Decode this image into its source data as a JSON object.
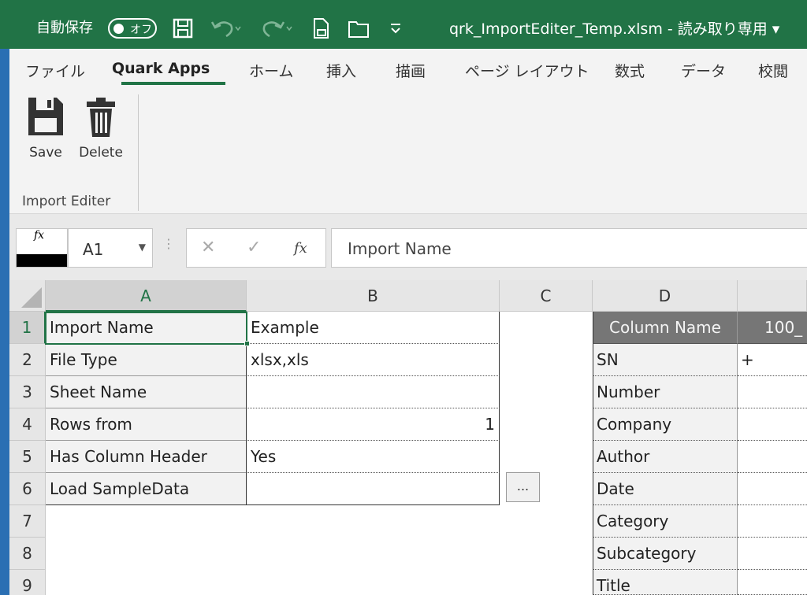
{
  "titlebar": {
    "autosave_label": "自動保存",
    "autosave_state": "オフ",
    "filename": "qrk_ImportEditer_Temp.xlsm  -  読み取り専用 ▾"
  },
  "tabs": [
    {
      "label": "ファイル"
    },
    {
      "label": "Quark Apps"
    },
    {
      "label": "ホーム"
    },
    {
      "label": "挿入"
    },
    {
      "label": "描画"
    },
    {
      "label": "ページ レイアウト"
    },
    {
      "label": "数式"
    },
    {
      "label": "データ"
    },
    {
      "label": "校閲"
    }
  ],
  "ribbon": {
    "save_label": "Save",
    "delete_label": "Delete",
    "group_label": "Import Editer"
  },
  "formula_bar": {
    "fx_label": "fx",
    "cell_ref": "A1",
    "cancel_glyph": "✕",
    "enter_glyph": "✓",
    "fx_button": "fx",
    "content": "Import Name"
  },
  "grid": {
    "columns": [
      "A",
      "B",
      "C",
      "D"
    ],
    "rows": [
      "1",
      "2",
      "3",
      "4",
      "5",
      "6",
      "7",
      "8",
      "9"
    ],
    "settings": [
      {
        "label": "Import Name",
        "value": "Example"
      },
      {
        "label": "File Type",
        "value": "xlsx,xls"
      },
      {
        "label": "Sheet Name",
        "value": ""
      },
      {
        "label": "Rows from",
        "value": "1"
      },
      {
        "label": "Has Column Header",
        "value": "Yes"
      },
      {
        "label": "Load SampleData",
        "value": ""
      }
    ],
    "load_button": "...",
    "mapping_header": "Column Name",
    "mapping_header_next": "100_",
    "mapping": [
      {
        "name": "SN",
        "value": "+"
      },
      {
        "name": "Number",
        "value": ""
      },
      {
        "name": "Company",
        "value": ""
      },
      {
        "name": "Author",
        "value": ""
      },
      {
        "name": "Date",
        "value": ""
      },
      {
        "name": "Category",
        "value": ""
      },
      {
        "name": "Subcategory",
        "value": ""
      },
      {
        "name": "Title",
        "value": ""
      }
    ]
  },
  "colors": {
    "excel_green": "#217346",
    "header_gray": "#767676"
  }
}
